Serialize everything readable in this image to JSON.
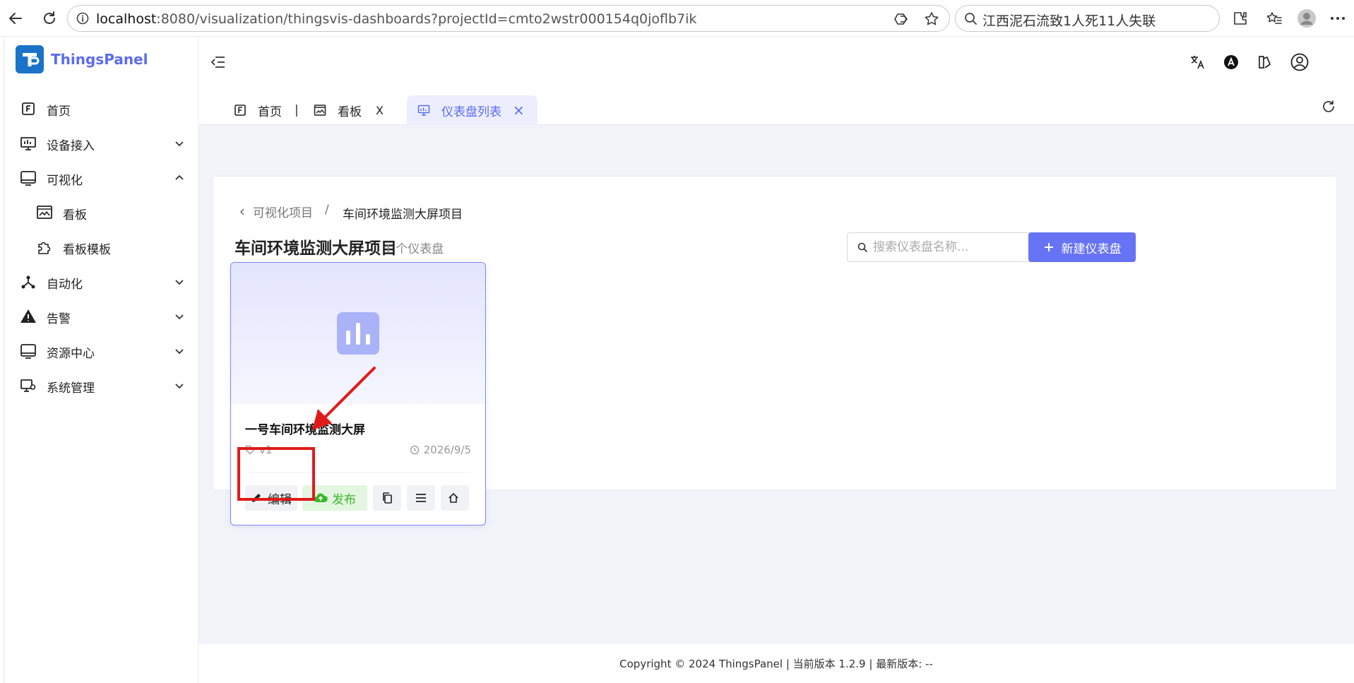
{
  "browser": {
    "url_host": "localhost",
    "url_path": ":8080/visualization/thingsvis-dashboards?projectId=cmto2wstr000154q0joflb7ik",
    "search_text": "江西泥石流致1人死11人失联"
  },
  "brand": {
    "name": "ThingsPanel",
    "accent": "#5b6cf0"
  },
  "sidebar": {
    "items": [
      {
        "label": "首页",
        "icon": "home-f-icon"
      },
      {
        "label": "设备接入",
        "icon": "monitor-icon"
      },
      {
        "label": "可视化",
        "icon": "display-icon"
      },
      {
        "label": "看板",
        "icon": "dashboard-image-icon"
      },
      {
        "label": "看板模板",
        "icon": "puzzle-icon"
      },
      {
        "label": "自动化",
        "icon": "flow-icon"
      },
      {
        "label": "告警",
        "icon": "warning-icon"
      },
      {
        "label": "资源中心",
        "icon": "display-icon"
      },
      {
        "label": "系统管理",
        "icon": "settings-monitor-icon"
      }
    ]
  },
  "tabs": [
    {
      "label": "首页"
    },
    {
      "label": "看板",
      "close": "X"
    },
    {
      "label": "仪表盘列表",
      "close": "×"
    }
  ],
  "breadcrumb": {
    "parent": "可视化项目",
    "separator": "/",
    "current": "车间环境监测大屏项目"
  },
  "page": {
    "title": "车间环境监测大屏项目",
    "count": "1 个仪表盘",
    "search_placeholder": "搜索仪表盘名称...",
    "new_button": "新建仪表盘"
  },
  "card": {
    "title": "一号车间环境监测大屏",
    "version": "v1",
    "date": "2026/9/5",
    "edit_label": "编辑",
    "publish_label": "发布"
  },
  "footer": {
    "text": "Copyright © 2024 ThingsPanel  |  当前版本 1.2.9  |  最新版本: --"
  }
}
